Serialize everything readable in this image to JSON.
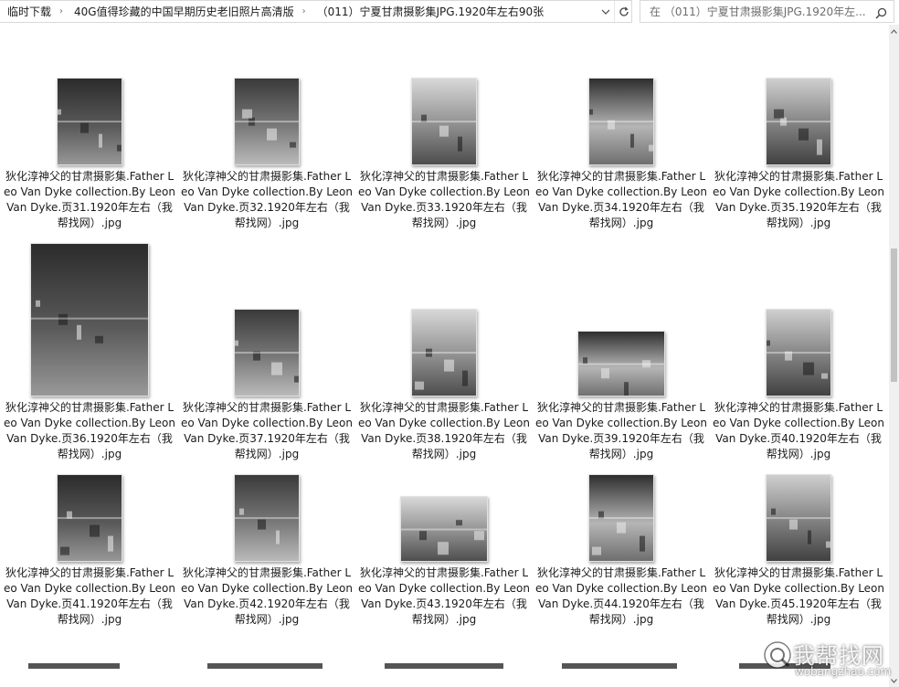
{
  "breadcrumb": {
    "items": [
      "临时下载",
      "40G值得珍藏的中国早期历史老旧照片高清版",
      "（011）宁夏甘肃摄影集JPG.1920年左右90张"
    ]
  },
  "search": {
    "placeholder": "在 （011）宁夏甘肃摄影集JPG.1920年左..."
  },
  "files": [
    {
      "name": "狄化淳神父的甘肃摄影集.Father Leo Van Dyke collection.By Leon Van Dyke.页31.1920年左右（我帮找网）.jpg",
      "orientation": "portrait"
    },
    {
      "name": "狄化淳神父的甘肃摄影集.Father Leo Van Dyke collection.By Leon Van Dyke.页32.1920年左右（我帮找网）.jpg",
      "orientation": "portrait"
    },
    {
      "name": "狄化淳神父的甘肃摄影集.Father Leo Van Dyke collection.By Leon Van Dyke.页33.1920年左右（我帮找网）.jpg",
      "orientation": "portrait"
    },
    {
      "name": "狄化淳神父的甘肃摄影集.Father Leo Van Dyke collection.By Leon Van Dyke.页34.1920年左右（我帮找网）.jpg",
      "orientation": "portrait"
    },
    {
      "name": "狄化淳神父的甘肃摄影集.Father Leo Van Dyke collection.By Leon Van Dyke.页35.1920年左右（我帮找网）.jpg",
      "orientation": "portrait"
    },
    {
      "name": "狄化淳神父的甘肃摄影集.Father Leo Van Dyke collection.By Leon Van Dyke.页36.1920年左右（我帮找网）.jpg",
      "orientation": "portrait"
    },
    {
      "name": "狄化淳神父的甘肃摄影集.Father Leo Van Dyke collection.By Leon Van Dyke.页37.1920年左右（我帮找网）.jpg",
      "orientation": "portrait"
    },
    {
      "name": "狄化淳神父的甘肃摄影集.Father Leo Van Dyke collection.By Leon Van Dyke.页38.1920年左右（我帮找网）.jpg",
      "orientation": "portrait"
    },
    {
      "name": "狄化淳神父的甘肃摄影集.Father Leo Van Dyke collection.By Leon Van Dyke.页39.1920年左右（我帮找网）.jpg",
      "orientation": "landscape"
    },
    {
      "name": "狄化淳神父的甘肃摄影集.Father Leo Van Dyke collection.By Leon Van Dyke.页40.1920年左右（我帮找网）.jpg",
      "orientation": "portrait"
    },
    {
      "name": "狄化淳神父的甘肃摄影集.Father Leo Van Dyke collection.By Leon Van Dyke.页41.1920年左右（我帮找网）.jpg",
      "orientation": "portrait"
    },
    {
      "name": "狄化淳神父的甘肃摄影集.Father Leo Van Dyke collection.By Leon Van Dyke.页42.1920年左右（我帮找网）.jpg",
      "orientation": "portrait"
    },
    {
      "name": "狄化淳神父的甘肃摄影集.Father Leo Van Dyke collection.By Leon Van Dyke.页43.1920年左右（我帮找网）.jpg",
      "orientation": "landscape"
    },
    {
      "name": "狄化淳神父的甘肃摄影集.Father Leo Van Dyke collection.By Leon Van Dyke.页44.1920年左右（我帮找网）.jpg",
      "orientation": "portrait"
    },
    {
      "name": "狄化淳神父的甘肃摄影集.Father Leo Van Dyke collection.By Leon Van Dyke.页45.1920年左右（我帮找网）.jpg",
      "orientation": "portrait"
    }
  ],
  "watermark": {
    "text": "我帮找网",
    "url": "wobangzhao.com"
  },
  "icons": {
    "separator": "chevron-right-icon",
    "dropdown": "chevron-down-icon",
    "refresh": "refresh-icon",
    "search": "search-icon",
    "scroll_up": "arrow-up-icon",
    "scroll_down": "arrow-down-icon"
  },
  "colors": {
    "text": "#1b1b1b",
    "border": "#d9d9d9",
    "scrollbar_thumb": "#c2c2c2"
  }
}
